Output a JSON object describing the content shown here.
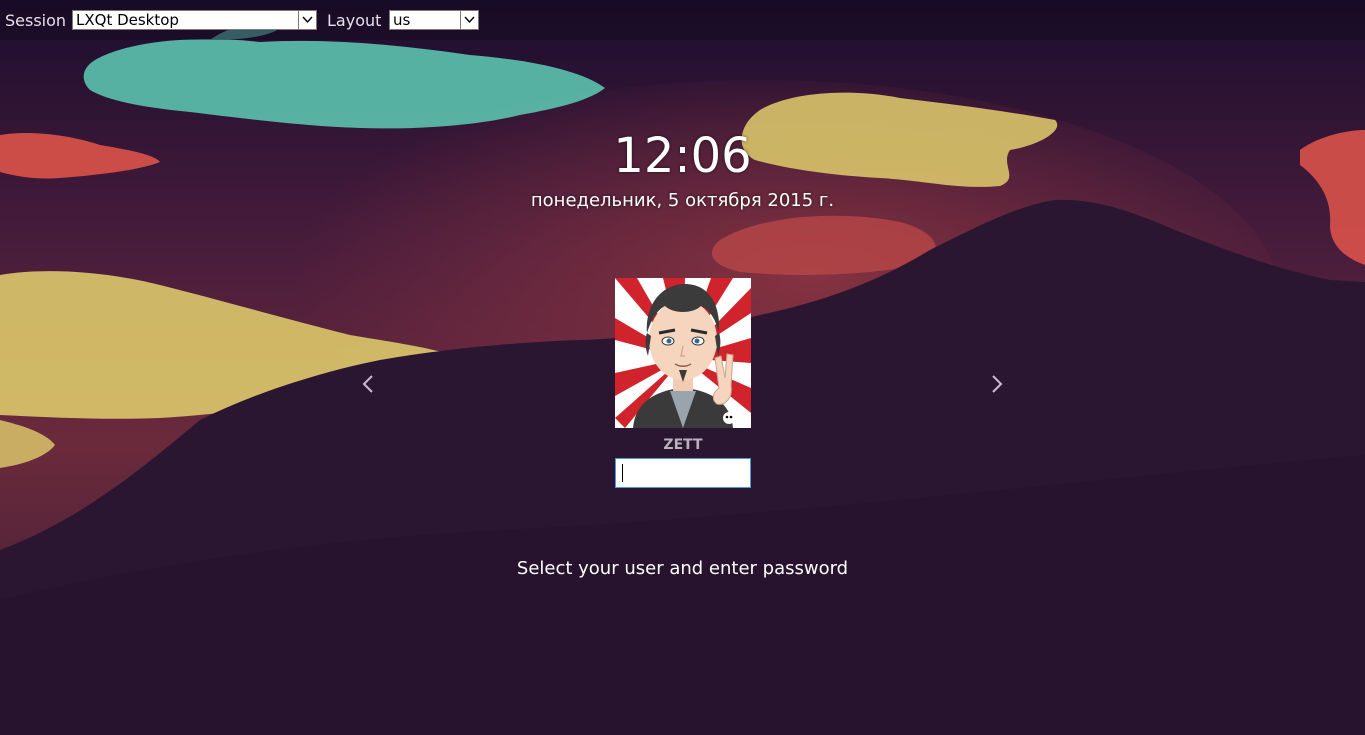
{
  "topbar": {
    "session_label": "Session",
    "session_value": "LXQt Desktop",
    "layout_label": "Layout",
    "layout_value": "us"
  },
  "clock": {
    "time": "12:06",
    "date": "понедельник, 5 октября 2015 г."
  },
  "user": {
    "name": "ZETT",
    "password_value": ""
  },
  "hint": "Select your user and enter password",
  "colors": {
    "sky": "#2a1530",
    "teal_cloud": "#5bbfad",
    "yellow_cloud": "#d9c46a",
    "red_cloud": "#d9524a",
    "mountain": "#2b1632",
    "input_focus_border": "#4a9bd6"
  },
  "icons": {
    "prev": "chevron-left-icon",
    "next": "chevron-right-icon",
    "dropdown": "chevron-down-icon"
  }
}
